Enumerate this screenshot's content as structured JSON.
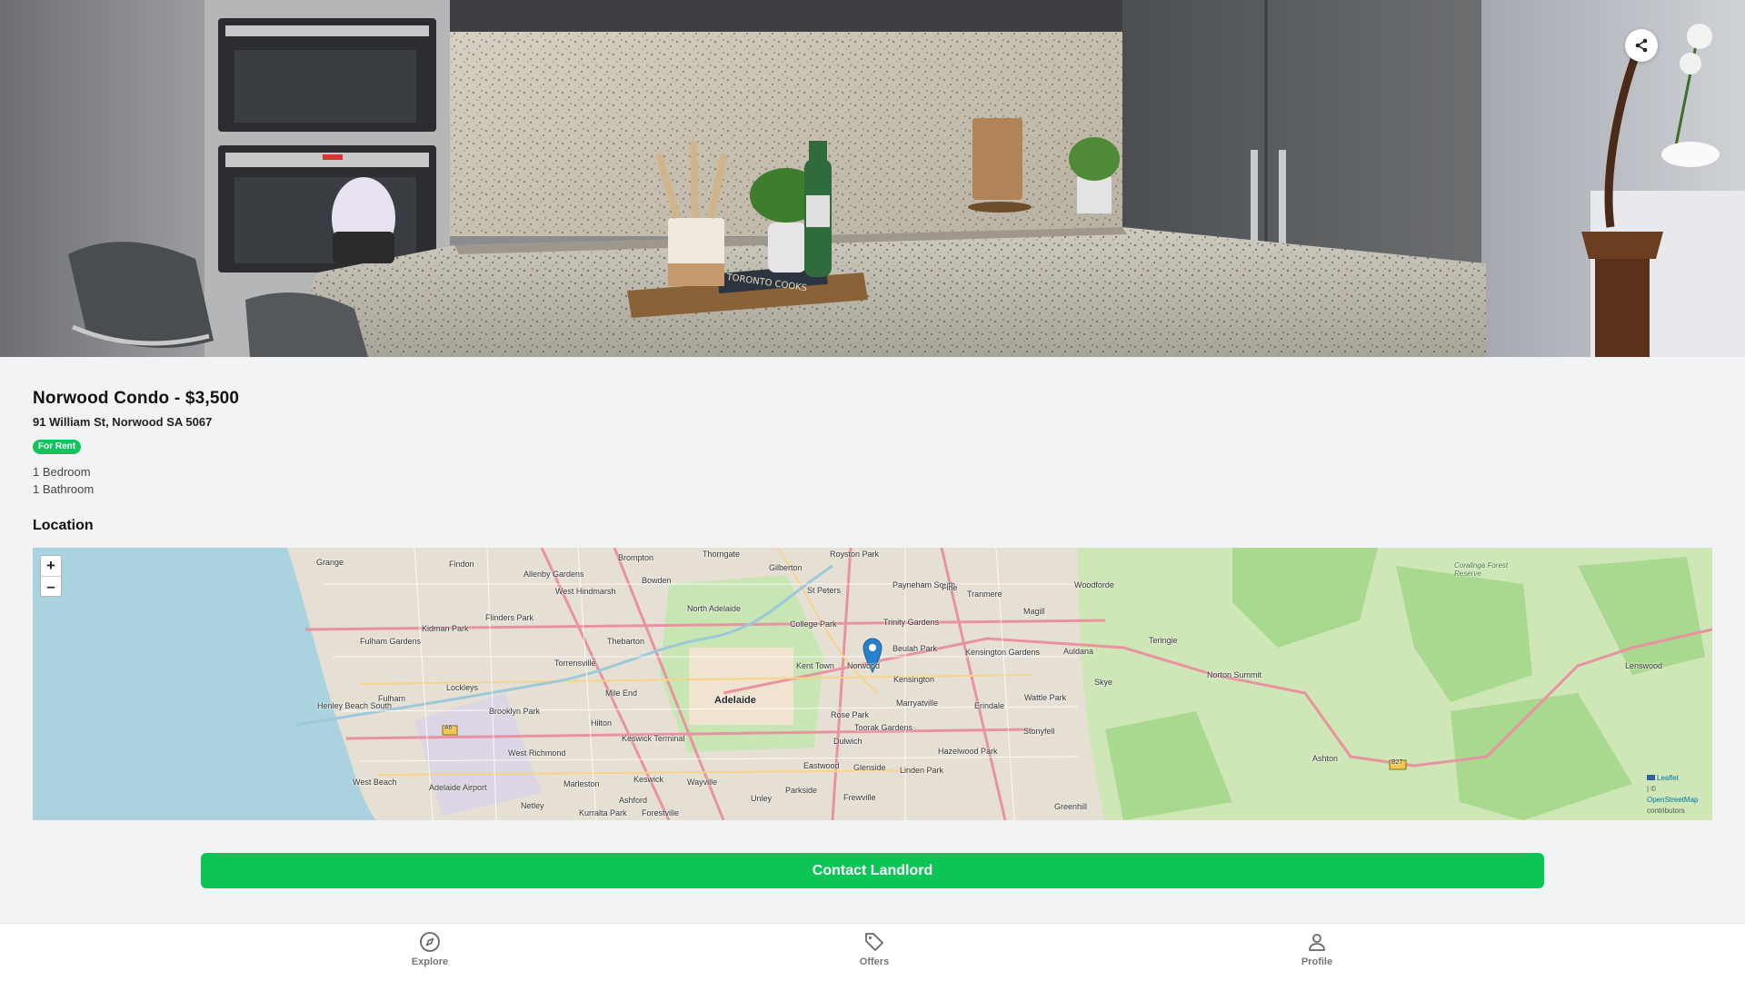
{
  "listing": {
    "title": "Norwood Condo - $3,500",
    "address": "91 William St, Norwood SA 5067",
    "status_badge": "For Rent",
    "bedrooms": "1 Bedroom",
    "bathrooms": "1 Bathroom"
  },
  "hero": {
    "share_icon": "share-icon",
    "book_title": "TORONTO COOKS"
  },
  "location": {
    "heading": "Location",
    "zoom_in": "+",
    "zoom_out": "–",
    "attribution_leaflet": "Leaflet",
    "attribution_sep": "| ©",
    "attribution_osm": "OpenStreetMap",
    "attribution_contrib": "contributors",
    "labels": {
      "grange": "Grange",
      "findon": "Findon",
      "brompton": "Brompton",
      "thorngate": "Thorngate",
      "gilberton": "Gilberton",
      "royston_park": "Royston Park",
      "payneham_south": "Payneham South",
      "firle": "Firle",
      "tranmere": "Tranmere",
      "magill": "Magill",
      "woodforde": "Woodforde",
      "allenby_gardens": "Allenby Gardens",
      "west_hindmarsh": "West Hindmarsh",
      "bowden": "Bowden",
      "north_adelaide": "North Adelaide",
      "st_peters": "St Peters",
      "flinders_park": "Flinders Park",
      "kidman_park": "Kidman Park",
      "college_park": "College Park",
      "trinity_gardens": "Trinity Gardens",
      "fulham_gardens": "Fulham Gardens",
      "thebarton": "Thebarton",
      "beulah_park": "Beulah Park",
      "kensington_gardens": "Kensington Gardens",
      "teringie": "Teringie",
      "auldana": "Auldana",
      "torrensville": "Torrensville",
      "kent_town": "Kent Town",
      "norwood": "Norwood",
      "kensington": "Kensington",
      "skye": "Skye",
      "norton_summit": "Norton Summit",
      "lockleys": "Lockleys",
      "fulham": "Fulham",
      "mile_end": "Mile End",
      "adelaide": "Adelaide",
      "marryatville": "Marryatville",
      "erindale": "Erindale",
      "wattle_park": "Wattle Park",
      "henley_beach_south": "Henley Beach South",
      "brooklyn_park": "Brooklyn Park",
      "hilton": "Hilton",
      "rose_park": "Rose Park",
      "toorak_gardens": "Toorak Gardens",
      "stonyfell": "Stonyfell",
      "keswick_terminal": "Keswick Terminal",
      "dulwich": "Dulwich",
      "west_richmond": "West Richmond",
      "hazelwood_park": "Hazelwood Park",
      "eastwood": "Eastwood",
      "glenside": "Glenside",
      "linden_park": "Linden Park",
      "west_beach": "West Beach",
      "adelaide_airport": "Adelaide Airport",
      "marleston": "Marleston",
      "keswick": "Keswick",
      "wayville": "Wayville",
      "parkside": "Parkside",
      "netley": "Netley",
      "ashford": "Ashford",
      "unley": "Unley",
      "frewville": "Frewville",
      "kurralta_park": "Kurralta Park",
      "forestville": "Forestville",
      "ashton": "Ashton",
      "lenswood": "Lenswood",
      "greenhill": "Greenhill",
      "coralinga": "Coralinga Forest Reserve",
      "a6": "A6",
      "b27": "B27"
    }
  },
  "actions": {
    "contact": "Contact Landlord"
  },
  "nav": {
    "explore": "Explore",
    "offers": "Offers",
    "profile": "Profile"
  },
  "colors": {
    "accent_green": "#0dc457",
    "badge_green": "#10c45c",
    "map_pin": "#2a81cb"
  }
}
